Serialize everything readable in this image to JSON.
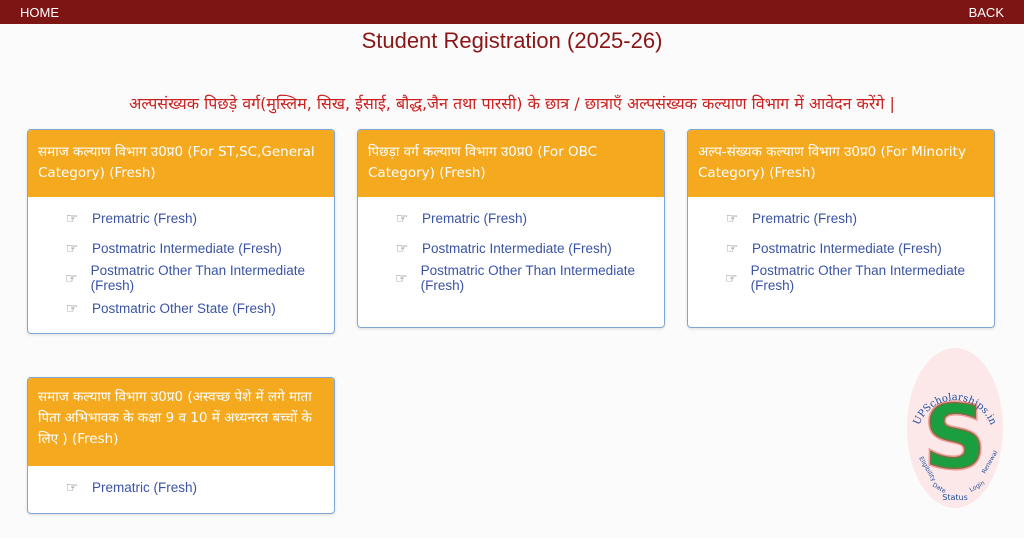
{
  "topbar": {
    "home": "HOME",
    "back": "BACK"
  },
  "title": "Student Registration (2025-26)",
  "notice": "अल्पसंख्यक पिछड़े वर्ग(मुस्लिम, सिख, ईसाई, बौद्ध,जैन तथा पारसी) के छात्र / छात्राएँ अल्पसंख्यक कल्याण विभाग में आवेदन करेंगे |",
  "colors": {
    "topbar": "#7d1515",
    "title": "#8a1515",
    "notice": "#cc1f1f",
    "card_header": "#f4a91f",
    "link": "#3a53a4",
    "card_border": "#7ea7d6"
  },
  "cards": [
    {
      "header": "समाज कल्याण विभाग उ0प्र0 (For ST,SC,General Category) (Fresh)",
      "links": [
        "Prematric (Fresh)",
        "Postmatric Intermediate (Fresh)",
        "Postmatric Other Than Intermediate (Fresh)",
        "Postmatric Other State (Fresh)"
      ]
    },
    {
      "header": "पिछड़ा वर्ग कल्याण विभाग उ0प्र0 (For OBC Category) (Fresh)",
      "links": [
        "Prematric (Fresh)",
        "Postmatric Intermediate (Fresh)",
        "Postmatric Other Than Intermediate (Fresh)"
      ]
    },
    {
      "header": "अल्प-संख्यक कल्याण विभाग उ0प्र0 (For Minority Category) (Fresh)",
      "links": [
        "Prematric (Fresh)",
        "Postmatric Intermediate (Fresh)",
        "Postmatric Other Than Intermediate (Fresh)"
      ]
    },
    {
      "header": "समाज कल्याण विभाग उ0प्र0 (अस्वच्छ पेशे में लगे माता पिता अभिभावक के कक्षा 9 व 10 में अध्यनरत बच्चों के लिए ) (Fresh)",
      "links": [
        "Prematric (Fresh)"
      ]
    }
  ],
  "watermark": {
    "top_text": "UPScholarships.in",
    "letter": "S",
    "word_left": "Eligibility",
    "word_mid_left": "Date",
    "word_mid": "Status",
    "word_mid_right": "Login",
    "word_right": "Renewal"
  },
  "icons": {
    "link_bullet": "pointing-hand-icon"
  }
}
